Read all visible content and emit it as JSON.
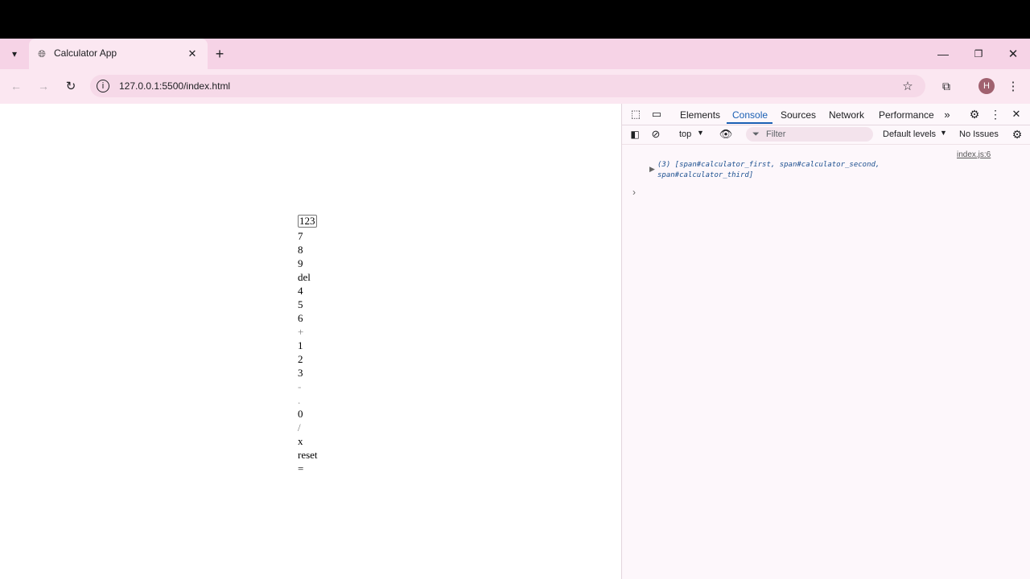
{
  "browser": {
    "tab_title": "Calculator App",
    "url": "127.0.0.1:5500/index.html",
    "profile_initial": "H"
  },
  "calculator": {
    "display": "123",
    "keys": [
      "7",
      "8",
      "9",
      "del",
      "4",
      "5",
      "6",
      "+",
      "1",
      "2",
      "3",
      "-",
      ".",
      "0",
      "/",
      "x",
      "reset",
      "="
    ]
  },
  "devtools": {
    "tabs": [
      "Elements",
      "Console",
      "Sources",
      "Network",
      "Performance"
    ],
    "active_tab": "Console",
    "context": "top",
    "filter_placeholder": "Filter",
    "levels": "Default levels",
    "issues": "No Issues",
    "log": {
      "text": "(3) [span#calculator_first, span#calculator_second, span#calculator_third]",
      "source": "index.js:6"
    },
    "prompt_symbol": "›"
  },
  "colors": {
    "accent": "#1a5fb4",
    "tabstrip": "#f6d3e6",
    "toolbar": "#fbe7f1"
  }
}
